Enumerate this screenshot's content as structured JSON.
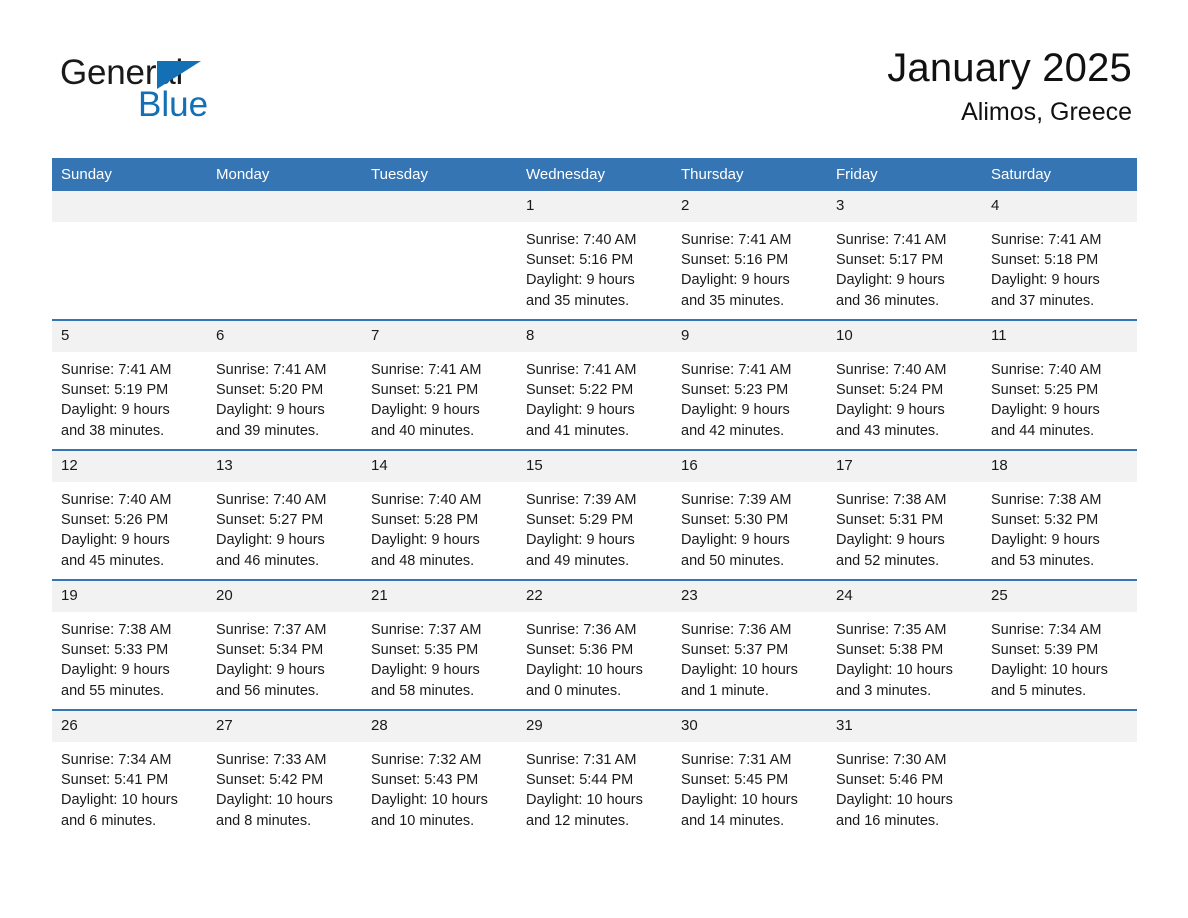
{
  "brand": {
    "name_part1": "General",
    "name_part2": "Blue",
    "flag_icon": "blue-triangle-flag-icon",
    "accent_color": "#1470b5"
  },
  "header": {
    "title": "January 2025",
    "location": "Alimos, Greece"
  },
  "theme": {
    "header_blue": "#3575b4",
    "row_divider_blue": "#3575b4",
    "daynum_background": "#f2f2f2",
    "page_background": "#ffffff"
  },
  "calendar": {
    "weekday_headers": [
      "Sunday",
      "Monday",
      "Tuesday",
      "Wednesday",
      "Thursday",
      "Friday",
      "Saturday"
    ],
    "weeks": [
      [
        {
          "day": "",
          "info": ""
        },
        {
          "day": "",
          "info": ""
        },
        {
          "day": "",
          "info": ""
        },
        {
          "day": "1",
          "info": "Sunrise: 7:40 AM\nSunset: 5:16 PM\nDaylight: 9 hours\nand 35 minutes."
        },
        {
          "day": "2",
          "info": "Sunrise: 7:41 AM\nSunset: 5:16 PM\nDaylight: 9 hours\nand 35 minutes."
        },
        {
          "day": "3",
          "info": "Sunrise: 7:41 AM\nSunset: 5:17 PM\nDaylight: 9 hours\nand 36 minutes."
        },
        {
          "day": "4",
          "info": "Sunrise: 7:41 AM\nSunset: 5:18 PM\nDaylight: 9 hours\nand 37 minutes."
        }
      ],
      [
        {
          "day": "5",
          "info": "Sunrise: 7:41 AM\nSunset: 5:19 PM\nDaylight: 9 hours\nand 38 minutes."
        },
        {
          "day": "6",
          "info": "Sunrise: 7:41 AM\nSunset: 5:20 PM\nDaylight: 9 hours\nand 39 minutes."
        },
        {
          "day": "7",
          "info": "Sunrise: 7:41 AM\nSunset: 5:21 PM\nDaylight: 9 hours\nand 40 minutes."
        },
        {
          "day": "8",
          "info": "Sunrise: 7:41 AM\nSunset: 5:22 PM\nDaylight: 9 hours\nand 41 minutes."
        },
        {
          "day": "9",
          "info": "Sunrise: 7:41 AM\nSunset: 5:23 PM\nDaylight: 9 hours\nand 42 minutes."
        },
        {
          "day": "10",
          "info": "Sunrise: 7:40 AM\nSunset: 5:24 PM\nDaylight: 9 hours\nand 43 minutes."
        },
        {
          "day": "11",
          "info": "Sunrise: 7:40 AM\nSunset: 5:25 PM\nDaylight: 9 hours\nand 44 minutes."
        }
      ],
      [
        {
          "day": "12",
          "info": "Sunrise: 7:40 AM\nSunset: 5:26 PM\nDaylight: 9 hours\nand 45 minutes."
        },
        {
          "day": "13",
          "info": "Sunrise: 7:40 AM\nSunset: 5:27 PM\nDaylight: 9 hours\nand 46 minutes."
        },
        {
          "day": "14",
          "info": "Sunrise: 7:40 AM\nSunset: 5:28 PM\nDaylight: 9 hours\nand 48 minutes."
        },
        {
          "day": "15",
          "info": "Sunrise: 7:39 AM\nSunset: 5:29 PM\nDaylight: 9 hours\nand 49 minutes."
        },
        {
          "day": "16",
          "info": "Sunrise: 7:39 AM\nSunset: 5:30 PM\nDaylight: 9 hours\nand 50 minutes."
        },
        {
          "day": "17",
          "info": "Sunrise: 7:38 AM\nSunset: 5:31 PM\nDaylight: 9 hours\nand 52 minutes."
        },
        {
          "day": "18",
          "info": "Sunrise: 7:38 AM\nSunset: 5:32 PM\nDaylight: 9 hours\nand 53 minutes."
        }
      ],
      [
        {
          "day": "19",
          "info": "Sunrise: 7:38 AM\nSunset: 5:33 PM\nDaylight: 9 hours\nand 55 minutes."
        },
        {
          "day": "20",
          "info": "Sunrise: 7:37 AM\nSunset: 5:34 PM\nDaylight: 9 hours\nand 56 minutes."
        },
        {
          "day": "21",
          "info": "Sunrise: 7:37 AM\nSunset: 5:35 PM\nDaylight: 9 hours\nand 58 minutes."
        },
        {
          "day": "22",
          "info": "Sunrise: 7:36 AM\nSunset: 5:36 PM\nDaylight: 10 hours\nand 0 minutes."
        },
        {
          "day": "23",
          "info": "Sunrise: 7:36 AM\nSunset: 5:37 PM\nDaylight: 10 hours\nand 1 minute."
        },
        {
          "day": "24",
          "info": "Sunrise: 7:35 AM\nSunset: 5:38 PM\nDaylight: 10 hours\nand 3 minutes."
        },
        {
          "day": "25",
          "info": "Sunrise: 7:34 AM\nSunset: 5:39 PM\nDaylight: 10 hours\nand 5 minutes."
        }
      ],
      [
        {
          "day": "26",
          "info": "Sunrise: 7:34 AM\nSunset: 5:41 PM\nDaylight: 10 hours\nand 6 minutes."
        },
        {
          "day": "27",
          "info": "Sunrise: 7:33 AM\nSunset: 5:42 PM\nDaylight: 10 hours\nand 8 minutes."
        },
        {
          "day": "28",
          "info": "Sunrise: 7:32 AM\nSunset: 5:43 PM\nDaylight: 10 hours\nand 10 minutes."
        },
        {
          "day": "29",
          "info": "Sunrise: 7:31 AM\nSunset: 5:44 PM\nDaylight: 10 hours\nand 12 minutes."
        },
        {
          "day": "30",
          "info": "Sunrise: 7:31 AM\nSunset: 5:45 PM\nDaylight: 10 hours\nand 14 minutes."
        },
        {
          "day": "31",
          "info": "Sunrise: 7:30 AM\nSunset: 5:46 PM\nDaylight: 10 hours\nand 16 minutes."
        },
        {
          "day": "",
          "info": ""
        }
      ]
    ]
  }
}
